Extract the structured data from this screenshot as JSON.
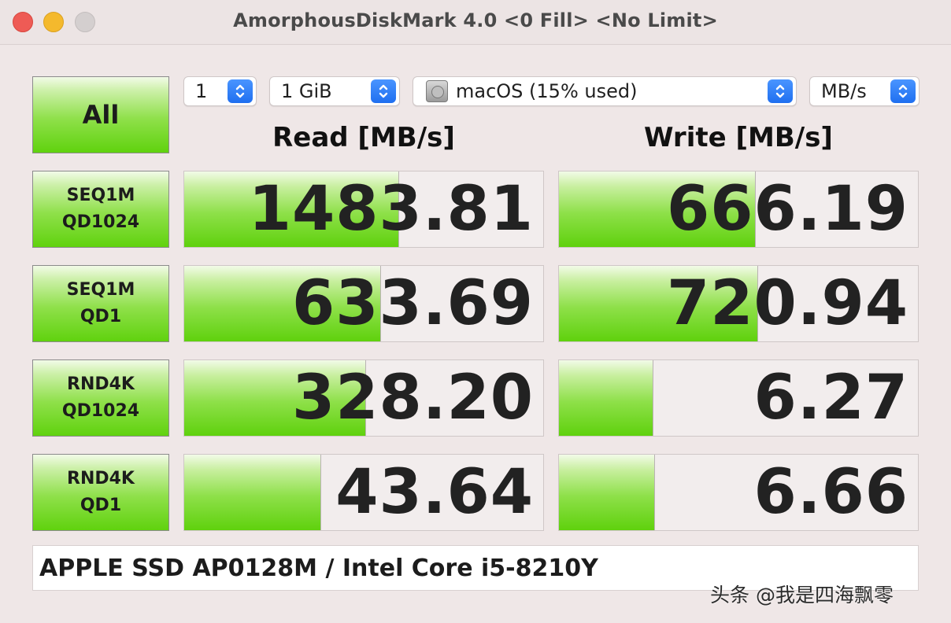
{
  "window": {
    "title": "AmorphousDiskMark 4.0 <0 Fill> <No Limit>"
  },
  "controls": {
    "all_label": "All",
    "count_value": "1",
    "size_value": "1 GiB",
    "volume_value": "macOS (15% used)",
    "unit_value": "MB/s"
  },
  "columns": {
    "read_header": "Read [MB/s]",
    "write_header": "Write [MB/s]"
  },
  "tests": [
    {
      "line1": "SEQ1M",
      "line2": "QD1024",
      "read": "1483.81",
      "write": "666.19",
      "read_fill": 0.596,
      "write_fill": 0.547
    },
    {
      "line1": "SEQ1M",
      "line2": "QD1",
      "read": "633.69",
      "write": "720.94",
      "read_fill": 0.545,
      "write_fill": 0.553
    },
    {
      "line1": "RND4K",
      "line2": "QD1024",
      "read": "328.20",
      "write": "6.27",
      "read_fill": 0.505,
      "write_fill": 0.26
    },
    {
      "line1": "RND4K",
      "line2": "QD1",
      "read": "43.64",
      "write": "6.66",
      "read_fill": 0.38,
      "write_fill": 0.265
    }
  ],
  "footer": {
    "device_info": "APPLE SSD AP0128M / Intel Core i5-8210Y"
  },
  "watermark": "头条 @我是四海飘零",
  "colors": {
    "bar_green": "#60d20e",
    "window_bg": "#efe7e7",
    "stepper_blue": "#1f6ff0"
  },
  "icons": {
    "close": "close-window-icon",
    "minimize": "minimize-window-icon",
    "zoom": "zoom-window-icon",
    "disk": "disk-drive-icon",
    "stepper": "chevron-up-down-icon"
  }
}
